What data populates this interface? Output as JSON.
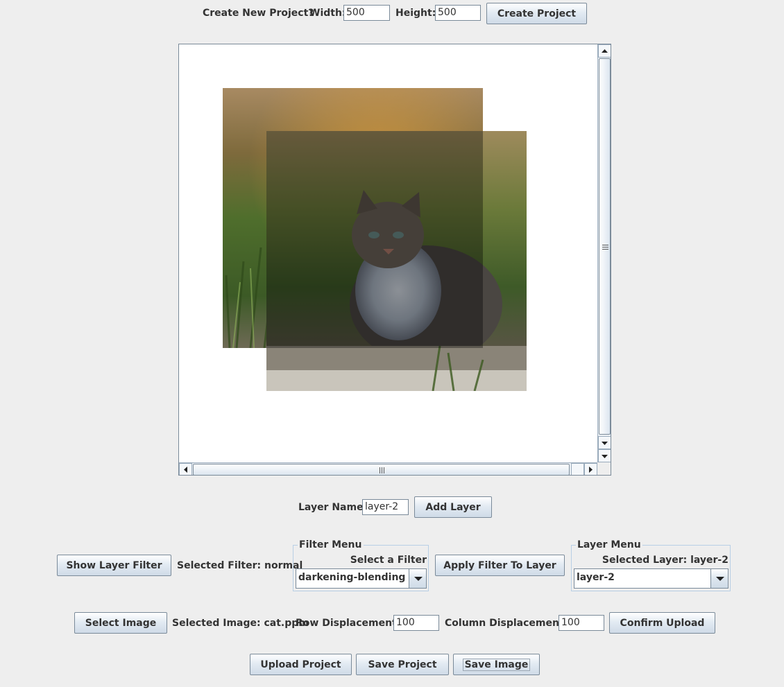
{
  "top_bar": {
    "prompt": "Create New Project?",
    "width_label": "Width:",
    "width_value": "500",
    "height_label": "Height:",
    "height_value": "500",
    "create_button": "Create Project"
  },
  "canvas": {
    "layers": [
      "cat.ppm",
      "cat.ppm"
    ]
  },
  "layer_row": {
    "name_label": "Layer Name:",
    "name_value": "layer-2",
    "add_button": "Add Layer"
  },
  "filter_row": {
    "show_filter_button": "Show Layer Filter",
    "selected_filter_text": "Selected Filter: normal",
    "filter_menu": {
      "title": "Filter Menu",
      "subtitle": "Select a Filter",
      "selected": "darkening-blending"
    },
    "apply_button": "Apply Filter To Layer",
    "layer_menu": {
      "title": "Layer Menu",
      "subtitle": "Selected Layer: layer-2",
      "selected": "layer-2"
    }
  },
  "image_row": {
    "select_button": "Select Image",
    "selected_image_text": "Selected Image: cat.ppm",
    "row_disp_label": "Row Displacement:",
    "row_disp_value": "100",
    "col_disp_label": "Column Displacement:",
    "col_disp_value": "100",
    "confirm_button": "Confirm Upload"
  },
  "bottom_row": {
    "upload_button": "Upload Project",
    "save_project_button": "Save Project",
    "save_image_button": "Save Image"
  }
}
